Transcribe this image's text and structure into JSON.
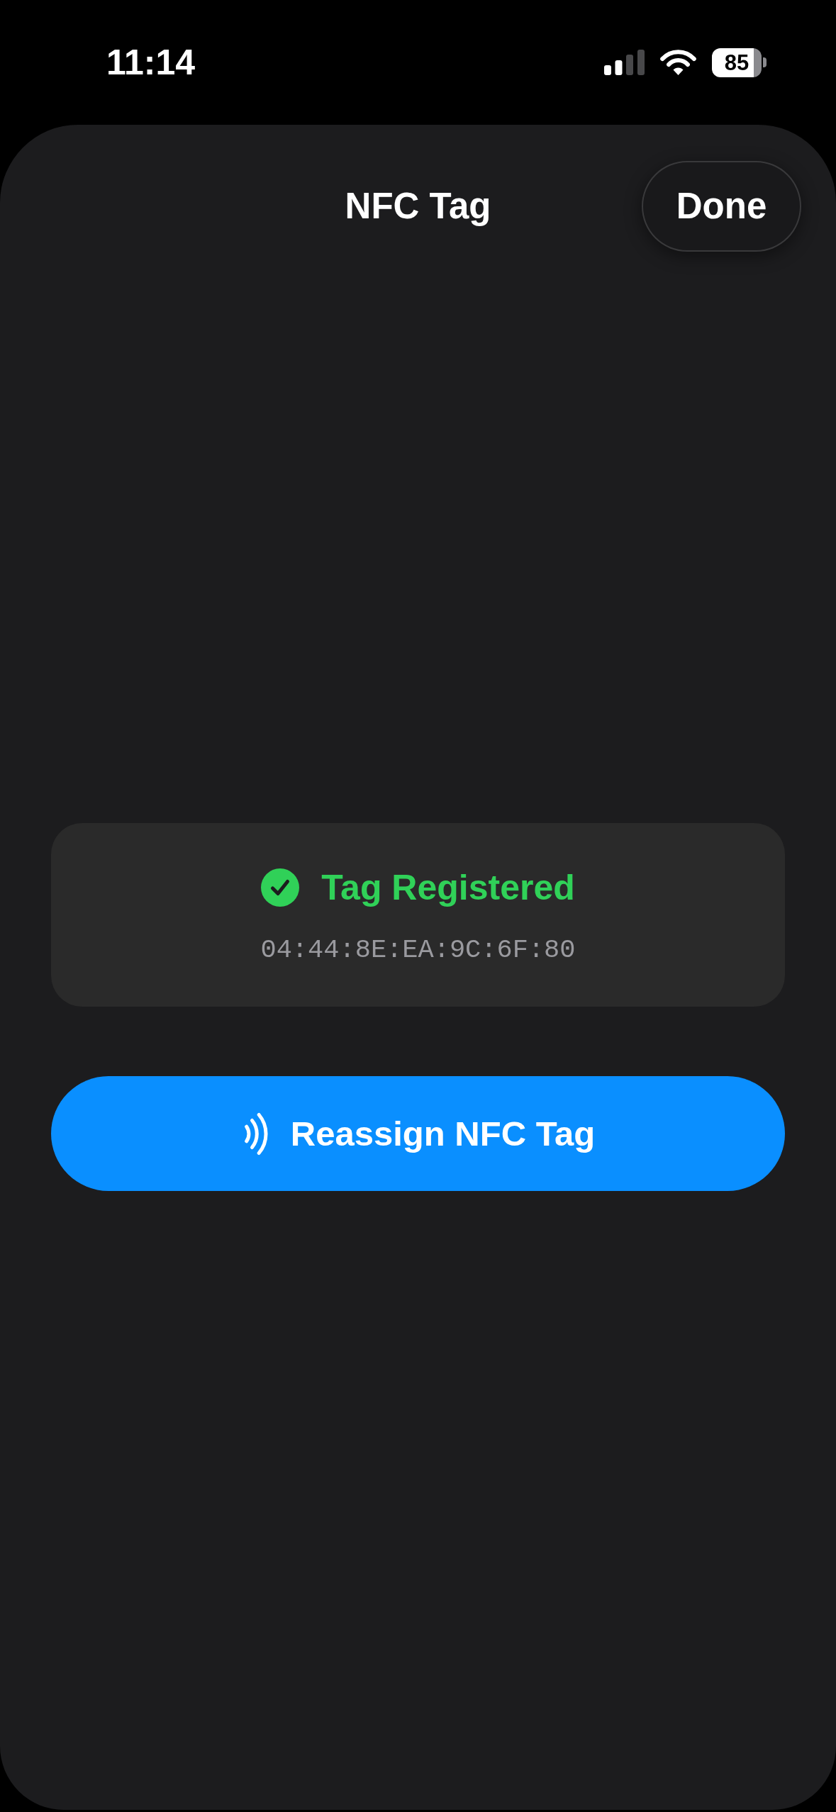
{
  "status_bar": {
    "time": "11:14",
    "battery": "85"
  },
  "sheet": {
    "title": "NFC Tag",
    "done_button": "Done"
  },
  "tag_card": {
    "registered": true,
    "status": "Tag Registered",
    "uid": "04:44:8E:EA:9C:6F:80"
  },
  "reassign_button": {
    "label": "Reassign NFC Tag"
  }
}
